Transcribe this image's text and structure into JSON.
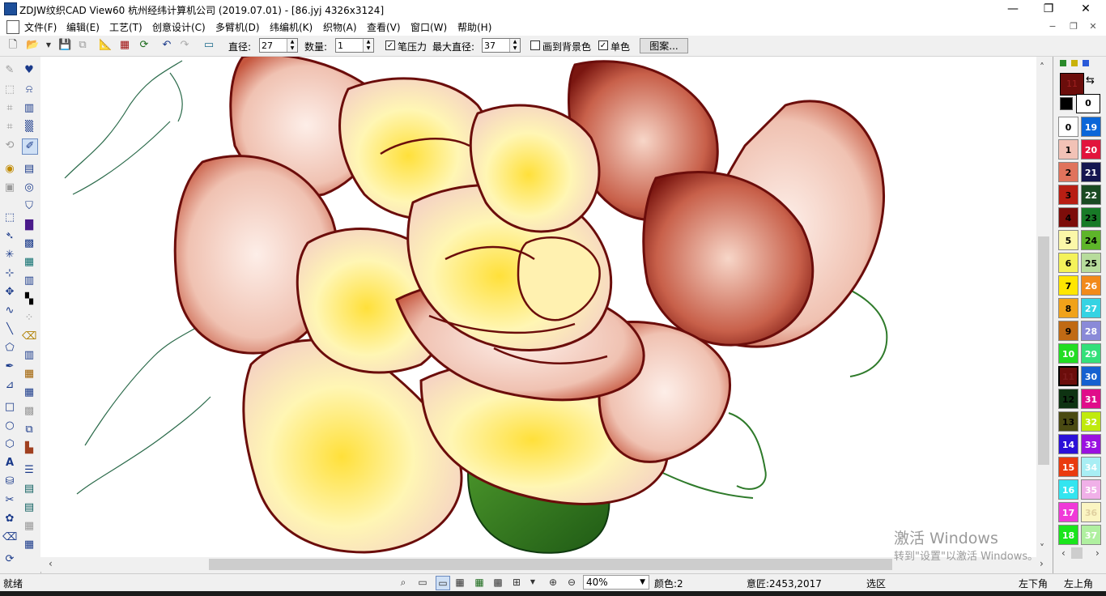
{
  "window": {
    "title": "ZDJW纹织CAD View60 杭州经纬计算机公司 (2019.07.01) - [86.jyj 4326x3124]",
    "minimize": "—",
    "restore": "❐",
    "close": "✕"
  },
  "menu": [
    "文件(F)",
    "编辑(E)",
    "工艺(T)",
    "创意设计(C)",
    "多臂机(D)",
    "纬编机(K)",
    "织物(A)",
    "查看(V)",
    "窗口(W)",
    "帮助(H)"
  ],
  "mdi": {
    "minimize": "−",
    "restore": "❐",
    "close": "✕"
  },
  "toolbar": {
    "diameter_label": "直径:",
    "diameter_value": "27",
    "count_label": "数量:",
    "count_value": "1",
    "pen_pressure_label": "笔压力",
    "pen_pressure_checked": "✓",
    "max_diameter_label": "最大直径:",
    "max_diameter_value": "37",
    "draw_bg_label": "画到背景色",
    "draw_bg_checked": "",
    "single_color_label": "单色",
    "single_color_checked": "✓",
    "pattern_button": "图案..."
  },
  "palette": {
    "current_color_index": "11",
    "current_color_hex": "#6b0d0b",
    "bg_index": "0",
    "swap_icon": "swap-arrows-icon",
    "swatches": [
      {
        "n": "0",
        "color": "#ffffff",
        "text": "#000000"
      },
      {
        "n": "19",
        "color": "#0a66d8",
        "text": "#ffffff"
      },
      {
        "n": "1",
        "color": "#f2c2b6",
        "text": "#000000"
      },
      {
        "n": "20",
        "color": "#e2153c",
        "text": "#ffffff"
      },
      {
        "n": "2",
        "color": "#e0735c",
        "text": "#000000"
      },
      {
        "n": "21",
        "color": "#141650",
        "text": "#ffffff"
      },
      {
        "n": "3",
        "color": "#b81e13",
        "text": "#000000"
      },
      {
        "n": "22",
        "color": "#1a4a22",
        "text": "#ffffff"
      },
      {
        "n": "4",
        "color": "#7d0d0a",
        "text": "#000000"
      },
      {
        "n": "23",
        "color": "#187a27",
        "text": "#000000"
      },
      {
        "n": "5",
        "color": "#fbf7a8",
        "text": "#000000"
      },
      {
        "n": "24",
        "color": "#5eb52a",
        "text": "#000000"
      },
      {
        "n": "6",
        "color": "#f4f25a",
        "text": "#000000"
      },
      {
        "n": "25",
        "color": "#b7dc9c",
        "text": "#000000"
      },
      {
        "n": "7",
        "color": "#ffe600",
        "text": "#000000"
      },
      {
        "n": "26",
        "color": "#f28a1a",
        "text": "#ffffff"
      },
      {
        "n": "8",
        "color": "#f0a21a",
        "text": "#000000"
      },
      {
        "n": "27",
        "color": "#35d3e3",
        "text": "#ffffff"
      },
      {
        "n": "9",
        "color": "#c06a14",
        "text": "#000000"
      },
      {
        "n": "28",
        "color": "#8a8ad8",
        "text": "#ffffff"
      },
      {
        "n": "10",
        "color": "#22dd22",
        "text": "#ffffff"
      },
      {
        "n": "29",
        "color": "#33e07a",
        "text": "#ffffff"
      },
      {
        "n": "11",
        "color": "#6b0d0b",
        "text": "#7a1a1a"
      },
      {
        "n": "30",
        "color": "#1560d0",
        "text": "#ffffff"
      },
      {
        "n": "12",
        "color": "#0e3312",
        "text": "#000000"
      },
      {
        "n": "31",
        "color": "#e00d8a",
        "text": "#ffffff"
      },
      {
        "n": "13",
        "color": "#4a4a12",
        "text": "#000000"
      },
      {
        "n": "32",
        "color": "#c0ea0e",
        "text": "#ffffff"
      },
      {
        "n": "14",
        "color": "#2a10d8",
        "text": "#ffffff"
      },
      {
        "n": "33",
        "color": "#9a10e0",
        "text": "#ffffff"
      },
      {
        "n": "15",
        "color": "#ea3a0e",
        "text": "#ffffff"
      },
      {
        "n": "34",
        "color": "#a8eef4",
        "text": "#ffffff"
      },
      {
        "n": "16",
        "color": "#33e5f0",
        "text": "#ffffff"
      },
      {
        "n": "35",
        "color": "#f0b0e8",
        "text": "#ffffff"
      },
      {
        "n": "17",
        "color": "#f03ad8",
        "text": "#ffffff"
      },
      {
        "n": "36",
        "color": "#fbf5c2",
        "text": "#e0d0a0"
      },
      {
        "n": "18",
        "color": "#19e51b",
        "text": "#ffffff"
      },
      {
        "n": "37",
        "color": "#b0f0a0",
        "text": "#ffffff"
      }
    ]
  },
  "status": {
    "ready": "就绪",
    "zoom": "40%",
    "color": "颜色:2",
    "coords": "意匠:2453,2017",
    "select": "选区",
    "corner_bl": "左下角",
    "corner_tl": "左上角"
  },
  "watermark": {
    "line1": "激活 Windows",
    "line2": "转到\"设置\"以激活 Windows。"
  }
}
